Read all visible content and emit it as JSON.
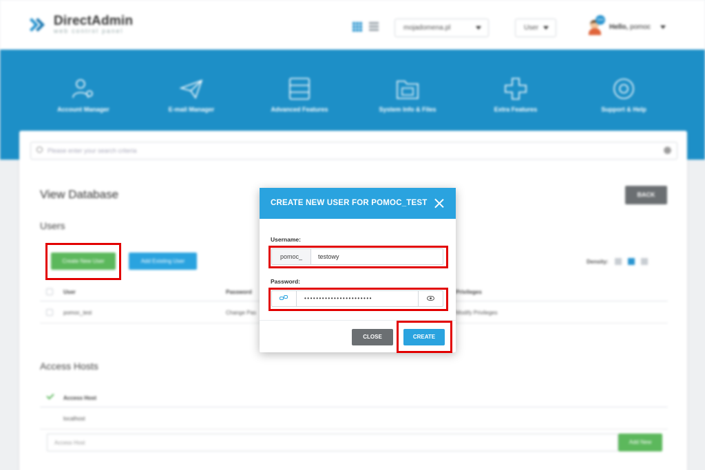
{
  "header": {
    "brand_name": "DirectAdmin",
    "brand_tagline": "web control panel",
    "domain_selected": "mojadomena.pl",
    "role_selected": "User",
    "avatar_badge": "new",
    "greeting": "Hello,",
    "username": "pomoc"
  },
  "nav": {
    "items": [
      {
        "label": "Account Manager",
        "icon": "users-gear-icon"
      },
      {
        "label": "E-mail Manager",
        "icon": "paper-plane-icon"
      },
      {
        "label": "Advanced Features",
        "icon": "server-stack-icon"
      },
      {
        "label": "System Info & Files",
        "icon": "folder-icon"
      },
      {
        "label": "Extra Features",
        "icon": "plus-icon"
      },
      {
        "label": "Support & Help",
        "icon": "lifebuoy-icon"
      }
    ]
  },
  "search": {
    "placeholder": "Please enter your search criteria"
  },
  "page": {
    "title": "View Database",
    "back_label": "BACK"
  },
  "users": {
    "section_title": "Users",
    "create_label": "Create New User",
    "add_existing_label": "Add Existing User",
    "density_label": "Density:",
    "columns": [
      "User",
      "Password",
      "Privileges"
    ],
    "rows": [
      {
        "user": "pomoc_test",
        "password_action": "Change Pas",
        "privileges_action": "Modify Privileges"
      }
    ]
  },
  "hosts": {
    "section_title": "Access Hosts",
    "column": "Access Host",
    "rows": [
      "localhost"
    ],
    "input_placeholder": "Access Host",
    "add_label": "Add New"
  },
  "modal": {
    "title": "CREATE NEW USER FOR POMOC_TEST",
    "username_label": "Username:",
    "username_prefix": "pomoc_",
    "username_value": "testowy",
    "password_label": "Password:",
    "password_value": "•••••••••••••••••••••••",
    "close_label": "CLOSE",
    "create_label": "CREATE"
  },
  "colors": {
    "brand_blue": "#1d8fc7",
    "modal_blue": "#2aa3df",
    "success_green": "#5cb85c",
    "highlight_red": "#e20000",
    "neutral_button": "#6b6f72"
  }
}
